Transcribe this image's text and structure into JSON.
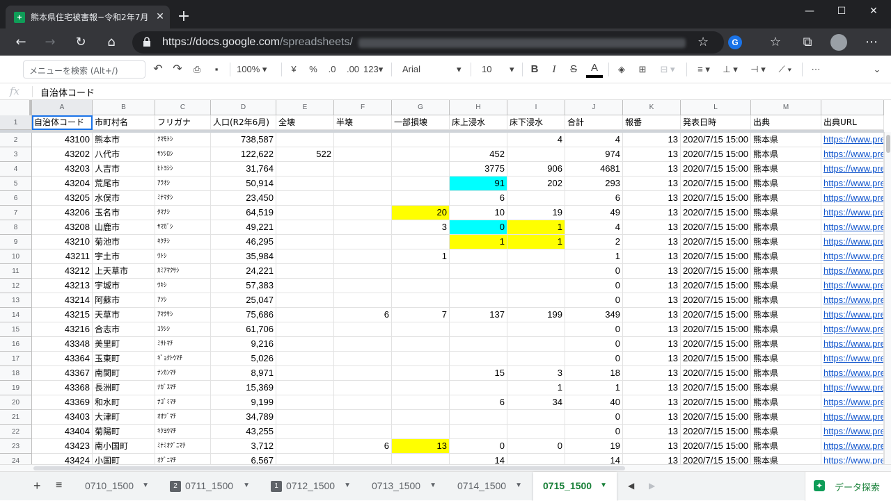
{
  "browser": {
    "tab_title": "熊本県住宅被害報−令和2年7月豪",
    "url_prefix": "https://docs.google.com",
    "url_path": "/spreadsheets/",
    "new_tab": "+",
    "minimize": "—",
    "maximize": "☐",
    "close": "✕"
  },
  "toolbar": {
    "menu_search_placeholder": "メニューを検索 (Alt+/)",
    "zoom": "100%",
    "currency": "¥",
    "percent": "%",
    "dec_decrease": ".0",
    "dec_increase": ".00",
    "more_formats": "123",
    "font": "Arial",
    "font_size": "10",
    "bold": "B",
    "italic": "I",
    "strike": "S",
    "text_color": "A",
    "more": "⋯"
  },
  "formula_bar": {
    "fx": "fx",
    "value": "自治体コード"
  },
  "columns": [
    "A",
    "B",
    "C",
    "D",
    "E",
    "F",
    "G",
    "H",
    "I",
    "J",
    "K",
    "L",
    "M",
    ""
  ],
  "headers": [
    "自治体コード",
    "市町村名",
    "フリガナ",
    "人口(R2年6月)",
    "全壊",
    "半壊",
    "一部損壊",
    "床上浸水",
    "床下浸水",
    "合計",
    "報番",
    "発表日時",
    "出典",
    "出典URL"
  ],
  "rows": [
    {
      "n": "2",
      "cells": [
        "43100",
        "熊本市",
        "ｸﾏﾓﾄｼ",
        "738,587",
        "",
        "",
        "",
        "",
        "4",
        "4",
        "13",
        "2020/7/15 15:00",
        "熊本県",
        "https://www.pre"
      ]
    },
    {
      "n": "3",
      "cells": [
        "43202",
        "八代市",
        "ﾔﾂｼﾛｼ",
        "122,622",
        "522",
        "",
        "",
        "452",
        "",
        "974",
        "13",
        "2020/7/15 15:00",
        "熊本県",
        "https://www.pre"
      ]
    },
    {
      "n": "4",
      "cells": [
        "43203",
        "人吉市",
        "ﾋﾄﾖｼｼ",
        "31,764",
        "",
        "",
        "",
        "3775",
        "906",
        "4681",
        "13",
        "2020/7/15 15:00",
        "熊本県",
        "https://www.pre"
      ]
    },
    {
      "n": "5",
      "cells": [
        "43204",
        "荒尾市",
        "ｱﾗｵｼ",
        "50,914",
        "",
        "",
        "",
        "91",
        "202",
        "293",
        "13",
        "2020/7/15 15:00",
        "熊本県",
        "https://www.pre"
      ]
    },
    {
      "n": "6",
      "cells": [
        "43205",
        "水俣市",
        "ﾐﾅﾏﾀｼ",
        "23,450",
        "",
        "",
        "",
        "6",
        "",
        "6",
        "13",
        "2020/7/15 15:00",
        "熊本県",
        "https://www.pre"
      ]
    },
    {
      "n": "7",
      "cells": [
        "43206",
        "玉名市",
        "ﾀﾏﾅｼ",
        "64,519",
        "",
        "",
        "20",
        "10",
        "19",
        "49",
        "13",
        "2020/7/15 15:00",
        "熊本県",
        "https://www.pre"
      ]
    },
    {
      "n": "8",
      "cells": [
        "43208",
        "山鹿市",
        "ﾔﾏｶﾞｼ",
        "49,221",
        "",
        "",
        "3",
        "0",
        "1",
        "4",
        "13",
        "2020/7/15 15:00",
        "熊本県",
        "https://www.pre"
      ]
    },
    {
      "n": "9",
      "cells": [
        "43210",
        "菊池市",
        "ｷｸﾁｼ",
        "46,295",
        "",
        "",
        "",
        "1",
        "1",
        "2",
        "13",
        "2020/7/15 15:00",
        "熊本県",
        "https://www.pre"
      ]
    },
    {
      "n": "10",
      "cells": [
        "43211",
        "宇土市",
        "ｳﾄｼ",
        "35,984",
        "",
        "",
        "1",
        "",
        "",
        "1",
        "13",
        "2020/7/15 15:00",
        "熊本県",
        "https://www.pre"
      ]
    },
    {
      "n": "11",
      "cells": [
        "43212",
        "上天草市",
        "ｶﾐｱﾏｸｻｼ",
        "24,221",
        "",
        "",
        "",
        "",
        "",
        "0",
        "13",
        "2020/7/15 15:00",
        "熊本県",
        "https://www.pre"
      ]
    },
    {
      "n": "12",
      "cells": [
        "43213",
        "宇城市",
        "ｳｷｼ",
        "57,383",
        "",
        "",
        "",
        "",
        "",
        "0",
        "13",
        "2020/7/15 15:00",
        "熊本県",
        "https://www.pre"
      ]
    },
    {
      "n": "13",
      "cells": [
        "43214",
        "阿蘇市",
        "ｱｿｼ",
        "25,047",
        "",
        "",
        "",
        "",
        "",
        "0",
        "13",
        "2020/7/15 15:00",
        "熊本県",
        "https://www.pre"
      ]
    },
    {
      "n": "14",
      "cells": [
        "43215",
        "天草市",
        "ｱﾏｸｻｼ",
        "75,686",
        "",
        "6",
        "7",
        "137",
        "199",
        "349",
        "13",
        "2020/7/15 15:00",
        "熊本県",
        "https://www.pre"
      ]
    },
    {
      "n": "15",
      "cells": [
        "43216",
        "合志市",
        "ｺｳｼｼ",
        "61,706",
        "",
        "",
        "",
        "",
        "",
        "0",
        "13",
        "2020/7/15 15:00",
        "熊本県",
        "https://www.pre"
      ]
    },
    {
      "n": "16",
      "cells": [
        "43348",
        "美里町",
        "ﾐｻﾄﾏﾁ",
        "9,216",
        "",
        "",
        "",
        "",
        "",
        "0",
        "13",
        "2020/7/15 15:00",
        "熊本県",
        "https://www.pre"
      ]
    },
    {
      "n": "17",
      "cells": [
        "43364",
        "玉東町",
        "ｷﾞｮｸﾄｳﾏﾁ",
        "5,026",
        "",
        "",
        "",
        "",
        "",
        "0",
        "13",
        "2020/7/15 15:00",
        "熊本県",
        "https://www.pre"
      ]
    },
    {
      "n": "18",
      "cells": [
        "43367",
        "南関町",
        "ﾅﾝｶﾝﾏﾁ",
        "8,971",
        "",
        "",
        "",
        "15",
        "3",
        "18",
        "13",
        "2020/7/15 15:00",
        "熊本県",
        "https://www.pre"
      ]
    },
    {
      "n": "19",
      "cells": [
        "43368",
        "長洲町",
        "ﾅｶﾞｽﾏﾁ",
        "15,369",
        "",
        "",
        "",
        "",
        "1",
        "1",
        "13",
        "2020/7/15 15:00",
        "熊本県",
        "https://www.pre"
      ]
    },
    {
      "n": "20",
      "cells": [
        "43369",
        "和水町",
        "ﾅｺﾞﾐﾏﾁ",
        "9,199",
        "",
        "",
        "",
        "6",
        "34",
        "40",
        "13",
        "2020/7/15 15:00",
        "熊本県",
        "https://www.pre"
      ]
    },
    {
      "n": "21",
      "cells": [
        "43403",
        "大津町",
        "ｵｵﾂﾞﾏﾁ",
        "34,789",
        "",
        "",
        "",
        "",
        "",
        "0",
        "13",
        "2020/7/15 15:00",
        "熊本県",
        "https://www.pre"
      ]
    },
    {
      "n": "22",
      "cells": [
        "43404",
        "菊陽町",
        "ｷｸﾖｳﾏﾁ",
        "43,255",
        "",
        "",
        "",
        "",
        "",
        "0",
        "13",
        "2020/7/15 15:00",
        "熊本県",
        "https://www.pre"
      ]
    },
    {
      "n": "23",
      "cells": [
        "43423",
        "南小国町",
        "ﾐﾅﾐｵｸﾞﾆﾏﾁ",
        "3,712",
        "",
        "6",
        "13",
        "0",
        "0",
        "19",
        "13",
        "2020/7/15 15:00",
        "熊本県",
        "https://www.pre"
      ]
    },
    {
      "n": "24",
      "cells": [
        "43424",
        "小国町",
        "ｵｸﾞﾆﾏﾁ",
        "6,567",
        "",
        "",
        "",
        "14",
        "",
        "14",
        "13",
        "2020/7/15 15:00",
        "熊本県",
        "https://www.pre"
      ]
    }
  ],
  "highlights": {
    "yellow": "#ffff00",
    "cyan": "#00ffff",
    "cells": [
      {
        "row": "5",
        "col": 7,
        "color": "cyan"
      },
      {
        "row": "7",
        "col": 6,
        "color": "yellow"
      },
      {
        "row": "8",
        "col": 7,
        "color": "cyan"
      },
      {
        "row": "8",
        "col": 8,
        "color": "yellow"
      },
      {
        "row": "9",
        "col": 7,
        "color": "yellow"
      },
      {
        "row": "9",
        "col": 8,
        "color": "yellow"
      },
      {
        "row": "23",
        "col": 6,
        "color": "yellow"
      }
    ]
  },
  "sheet_tabs": [
    {
      "label": "0710_1500",
      "badge": ""
    },
    {
      "label": "0711_1500",
      "badge": "2"
    },
    {
      "label": "0712_1500",
      "badge": "1"
    },
    {
      "label": "0713_1500",
      "badge": ""
    },
    {
      "label": "0714_1500",
      "badge": ""
    },
    {
      "label": "0715_1500",
      "badge": "",
      "active": true
    }
  ],
  "explore_label": "データ探索",
  "accent": "#188038"
}
